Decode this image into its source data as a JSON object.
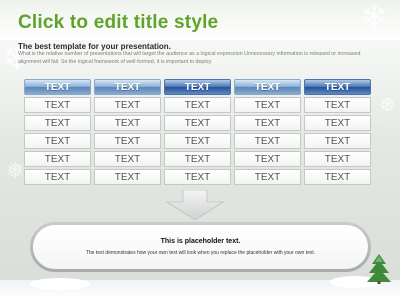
{
  "slide": {
    "title": "Click to edit title style",
    "subtitle": "The best template for your presentation.",
    "description": "What is the relative number of presentations that will target the audience as a logical expression Unnecessary information is released or increased alignment will fail. So the logical framework of well-formed, it is important to deploy."
  },
  "table": {
    "headers": [
      "TEXT",
      "TEXT",
      "TEXT",
      "TEXT",
      "TEXT"
    ],
    "rows": [
      [
        "TEXT",
        "TEXT",
        "TEXT",
        "TEXT",
        "TEXT"
      ],
      [
        "TEXT",
        "TEXT",
        "TEXT",
        "TEXT",
        "TEXT"
      ],
      [
        "TEXT",
        "TEXT",
        "TEXT",
        "TEXT",
        "TEXT"
      ],
      [
        "TEXT",
        "TEXT",
        "TEXT",
        "TEXT",
        "TEXT"
      ],
      [
        "TEXT",
        "TEXT",
        "TEXT",
        "TEXT",
        "TEXT"
      ]
    ]
  },
  "callout": {
    "title": "This is placeholder text.",
    "text": "The text demonstrates how your own text will look when you replace the placeholder with your own text."
  },
  "colors": {
    "title_green": "#5fa32a",
    "header_light_blue": "#8bb0d6",
    "header_dark_blue": "#25519b"
  },
  "icons": {
    "background": "snowflake-icon",
    "arrow": "down-arrow-icon",
    "decoration": "pine-tree-icon"
  }
}
